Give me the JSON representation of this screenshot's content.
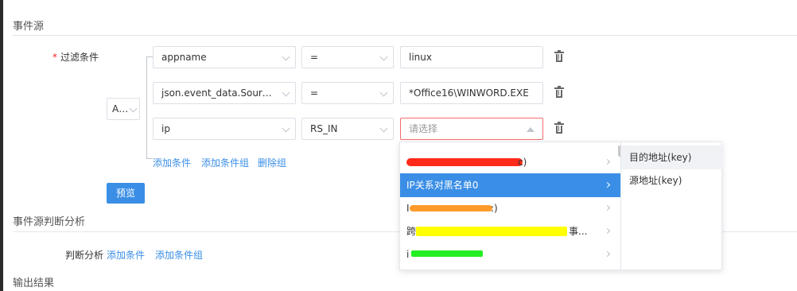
{
  "sections": {
    "event_source": "事件源",
    "event_analysis": "事件源判断分析",
    "output_result": "输出结果"
  },
  "filter": {
    "label": "过滤条件",
    "logic_operator": "AND",
    "rows": [
      {
        "field": "appname",
        "operator": "=",
        "value": "linux"
      },
      {
        "field": "json.event_data.SourceIm...",
        "operator": "=",
        "value": "*Office16\\WINWORD.EXE"
      },
      {
        "field": "ip",
        "operator": "RS_IN",
        "value": "",
        "placeholder": "请选择"
      }
    ],
    "actions": {
      "add_condition": "添加条件",
      "add_condition_group": "添加条件组",
      "delete_group": "删除组"
    },
    "preview_button": "预览"
  },
  "analysis": {
    "label": "判断分析",
    "add_condition": "添加条件",
    "add_condition_group": "添加条件组"
  },
  "dropdown": {
    "level1": [
      {
        "label": "c)",
        "redacted_color": "#ff2a1a"
      },
      {
        "label": "IP关系对黑名单0",
        "selected": true
      },
      {
        "label": ":)",
        "redacted_color": "#ff9a2a"
      },
      {
        "label": "事...",
        "prefix": "跨",
        "redacted_color": "#ffff00"
      },
      {
        "label": "",
        "prefix": "i",
        "redacted_color": "#22ee22"
      }
    ],
    "level2": [
      {
        "label": "目的地址(key)",
        "hover": true
      },
      {
        "label": "源地址(key)"
      }
    ]
  },
  "colors": {
    "primary": "#3a8ee6",
    "error": "#f56c6c",
    "required": "#f5222d"
  }
}
